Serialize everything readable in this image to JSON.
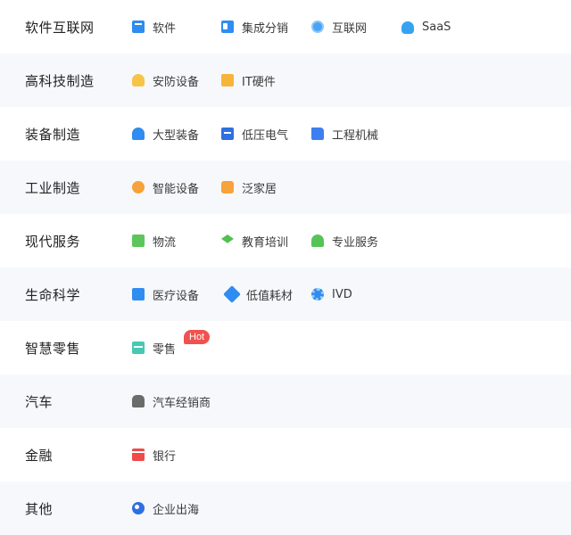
{
  "categories": [
    {
      "name": "软件互联网",
      "items": [
        {
          "label": "软件",
          "icon": "software-icon",
          "color": "#2f8cf0"
        },
        {
          "label": "集成分销",
          "icon": "integration-icon",
          "color": "#2f8cf0"
        },
        {
          "label": "互联网",
          "icon": "internet-icon",
          "color": "#4aa3f5"
        },
        {
          "label": "SaaS",
          "icon": "cloud-icon",
          "color": "#36a3f2"
        }
      ]
    },
    {
      "name": "高科技制造",
      "items": [
        {
          "label": "安防设备",
          "icon": "security-icon",
          "color": "#f8c447"
        },
        {
          "label": "IT硬件",
          "icon": "monitor-icon",
          "color": "#f7b43a"
        }
      ]
    },
    {
      "name": "装备制造",
      "items": [
        {
          "label": "大型装备",
          "icon": "large-equipment-icon",
          "color": "#2f8cf0"
        },
        {
          "label": "低压电气",
          "icon": "battery-icon",
          "color": "#2f6fe0"
        },
        {
          "label": "工程机械",
          "icon": "truck-icon",
          "color": "#3d7ff0"
        }
      ]
    },
    {
      "name": "工业制造",
      "items": [
        {
          "label": "智能设备",
          "icon": "smart-device-icon",
          "color": "#f7a23a"
        },
        {
          "label": "泛家居",
          "icon": "sofa-icon",
          "color": "#f7a23a"
        }
      ]
    },
    {
      "name": "现代服务",
      "items": [
        {
          "label": "物流",
          "icon": "delivery-truck-icon",
          "color": "#5cc65c"
        },
        {
          "label": "教育培训",
          "icon": "graduation-cap-icon",
          "color": "#52bf52"
        },
        {
          "label": "专业服务",
          "icon": "person-icon",
          "color": "#57c357"
        }
      ]
    },
    {
      "name": "生命科学",
      "items": [
        {
          "label": "医疗设备",
          "icon": "medical-image-icon",
          "color": "#2f8cf0"
        },
        {
          "label": "低值耗材",
          "icon": "pen-icon",
          "color": "#2f8cf0"
        },
        {
          "label": "IVD",
          "icon": "virus-icon",
          "color": "#2f8cf0"
        }
      ]
    },
    {
      "name": "智慧零售",
      "items": [
        {
          "label": "零售",
          "icon": "store-icon",
          "color": "#46c8b4",
          "badge": "Hot"
        }
      ]
    },
    {
      "name": "汽车",
      "items": [
        {
          "label": "汽车经销商",
          "icon": "car-icon",
          "color": "#6b6b6b"
        }
      ]
    },
    {
      "name": "金融",
      "items": [
        {
          "label": "银行",
          "icon": "bank-card-icon",
          "color": "#f04a4a"
        }
      ]
    },
    {
      "name": "其他",
      "items": [
        {
          "label": "企业出海",
          "icon": "globe-icon",
          "color": "#2f6fe0"
        }
      ]
    }
  ]
}
